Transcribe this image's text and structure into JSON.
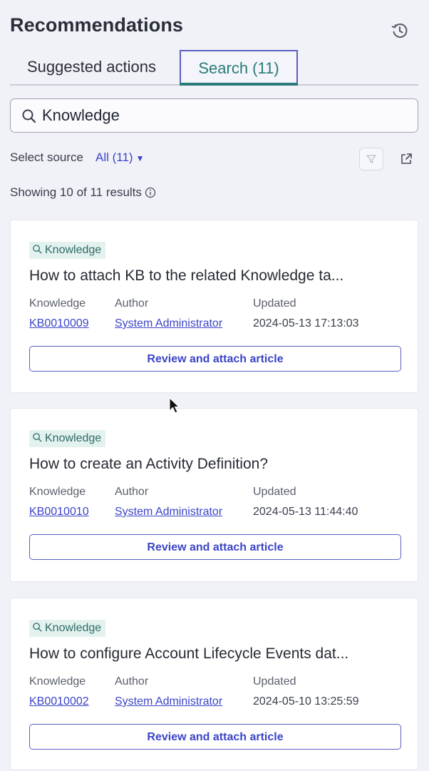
{
  "header": {
    "title": "Recommendations",
    "history_icon": "history-icon"
  },
  "tabs": [
    {
      "label": "Suggested actions",
      "active": false
    },
    {
      "label": "Search (11)",
      "active": true
    }
  ],
  "search": {
    "value": "Knowledge",
    "icon": "search-icon"
  },
  "source": {
    "label": "Select source",
    "value": "All (11)"
  },
  "results": {
    "summary": "Showing 10 of 11 results"
  },
  "colors": {
    "accent": "#3b44c7",
    "tab_active": "#2a7a78",
    "tag_bg": "#e3f2ef"
  },
  "cards": [
    {
      "tag": "Knowledge",
      "title": "How to attach KB to the related Knowledge ta...",
      "labels": {
        "number": "Knowledge",
        "author": "Author",
        "updated": "Updated"
      },
      "number": "KB0010009",
      "author": "System Administrator",
      "updated": "2024-05-13 17:13:03",
      "action": "Review and attach article"
    },
    {
      "tag": "Knowledge",
      "title": "How to create an Activity Definition?",
      "labels": {
        "number": "Knowledge",
        "author": "Author",
        "updated": "Updated"
      },
      "number": "KB0010010",
      "author": "System Administrator",
      "updated": "2024-05-13 11:44:40",
      "action": "Review and attach article"
    },
    {
      "tag": "Knowledge",
      "title": "How to configure Account Lifecycle Events dat...",
      "labels": {
        "number": "Knowledge",
        "author": "Author",
        "updated": "Updated"
      },
      "number": "KB0010002",
      "author": "System Administrator",
      "updated": "2024-05-10 13:25:59",
      "action": "Review and attach article"
    }
  ]
}
